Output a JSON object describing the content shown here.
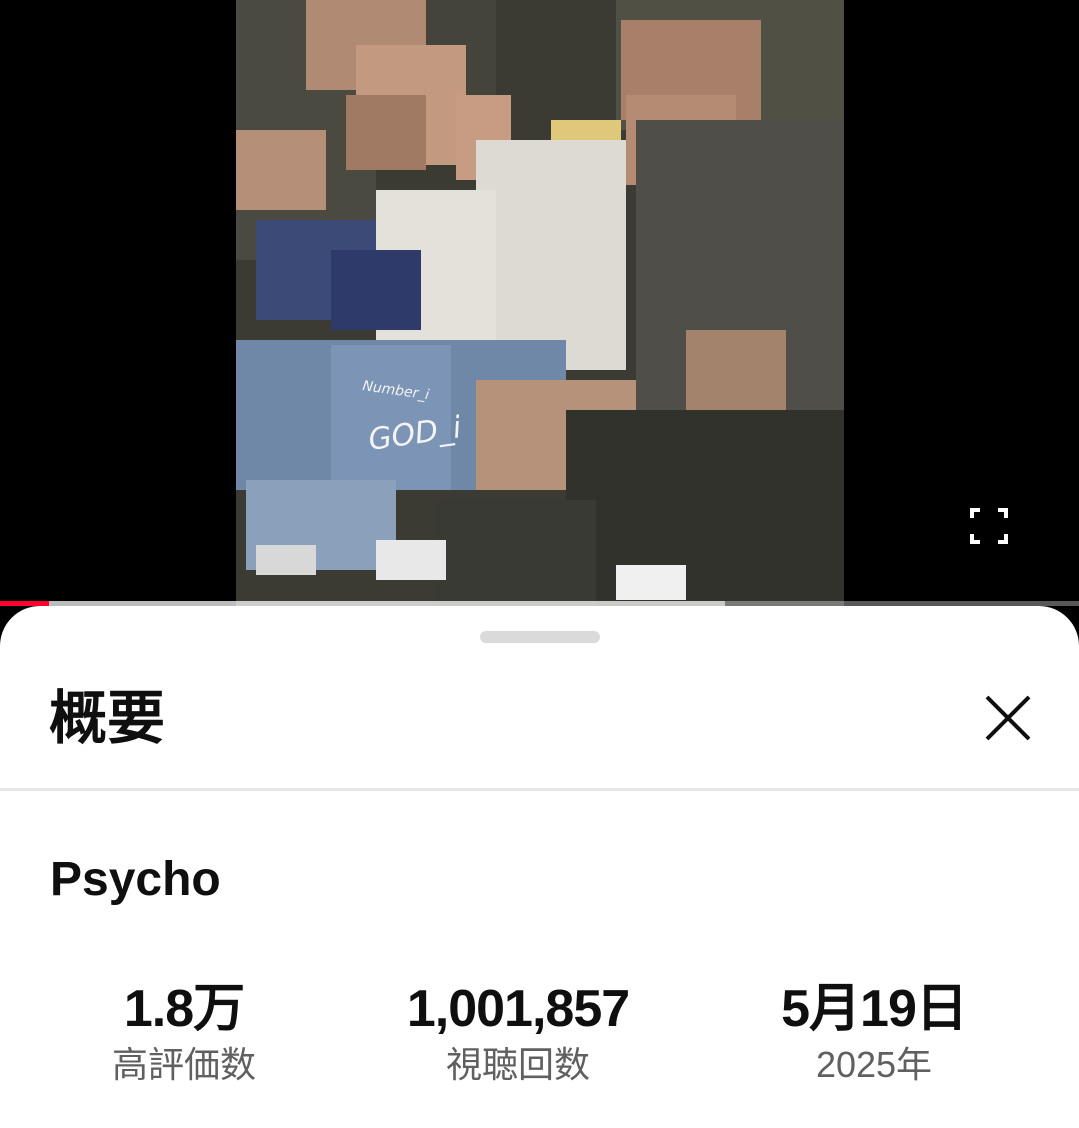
{
  "player": {
    "artwork_text_top": "Number_i",
    "artwork_text_main": "GOD_i",
    "fullscreen_icon": "fullscreen-icon",
    "progress_played": 0.045,
    "progress_buffered": 0.672
  },
  "sheet": {
    "title": "概要",
    "close_icon": "close-icon",
    "video_title": "Psycho",
    "stats": {
      "likes": {
        "value": "1.8万",
        "label": "高評価数"
      },
      "views": {
        "value": "1,001,857",
        "label": "視聴回数"
      },
      "date": {
        "value": "5月19日",
        "label": "2025年"
      }
    }
  },
  "colors": {
    "accent_red": "#ff0033",
    "text_primary": "#0f0f0f",
    "text_secondary": "#606060",
    "divider": "#e6e6e6"
  }
}
